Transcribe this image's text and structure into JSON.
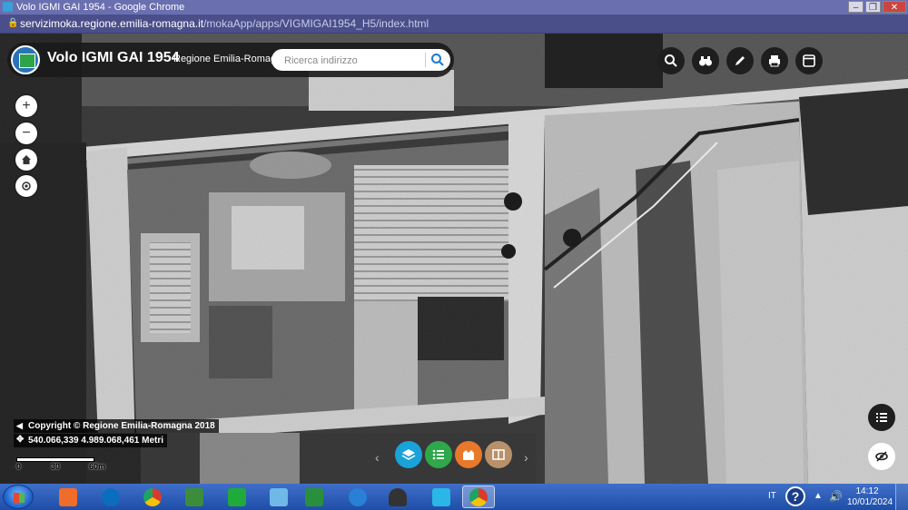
{
  "window": {
    "title": "Volo IGMI GAI 1954 - Google Chrome",
    "minimize": "–",
    "maximize": "❐",
    "close": "✕"
  },
  "address": {
    "lock": "🔒",
    "url_host": "servizimoka.regione.emilia-romagna.it",
    "url_path": "/mokaApp/apps/VIGMIGAI1954_H5/index.html"
  },
  "app": {
    "title": "Volo IGMI GAI 1954",
    "subtitle": "Regione Emilia-Romagna",
    "search_placeholder": "Ricerca indirizzo"
  },
  "tools": [
    {
      "name": "search-tool-button",
      "icon": "search-icon"
    },
    {
      "name": "feature-info-button",
      "icon": "binoculars-icon"
    },
    {
      "name": "draw-button",
      "icon": "pencil-icon"
    },
    {
      "name": "print-button",
      "icon": "printer-icon"
    },
    {
      "name": "layout-button",
      "icon": "window-icon"
    }
  ],
  "left_controls": {
    "zoom_in": "+",
    "zoom_out": "−"
  },
  "map_info": {
    "copyright": "Copyright © Regione Emilia-Romagna 2018",
    "coordinates": "540.066,339 4.989.068,461 Metri",
    "scale_labels": [
      "0",
      "30",
      "60m"
    ]
  },
  "bottom_toolbar": {
    "prev": "‹",
    "next": "›",
    "colors": {
      "layers": "#1aa3d9",
      "legend": "#2ea84a",
      "basemap": "#e8782a",
      "compare": "#b8906a"
    }
  },
  "taskbar": {
    "language": "IT",
    "help": "?",
    "time": "14:12",
    "date": "10/01/2024",
    "apps": [
      {
        "name": "media-app",
        "color": "#f06c2a"
      },
      {
        "name": "hp-app",
        "color": "#0a6ebd"
      },
      {
        "name": "chrome-app",
        "color": "#d93b2b"
      },
      {
        "name": "feather-app",
        "color": "#3c8c3c"
      },
      {
        "name": "green-app",
        "color": "#1faa3a"
      },
      {
        "name": "files-app",
        "color": "#6fb8e8"
      },
      {
        "name": "transfer-app",
        "color": "#2a8f3c"
      },
      {
        "name": "ie-app",
        "color": "#2a7fd6"
      },
      {
        "name": "dark-app",
        "color": "#333333"
      },
      {
        "name": "network-app",
        "color": "#2ab6e8"
      },
      {
        "name": "chrome-active-app",
        "color": "#d93b2b"
      }
    ]
  }
}
